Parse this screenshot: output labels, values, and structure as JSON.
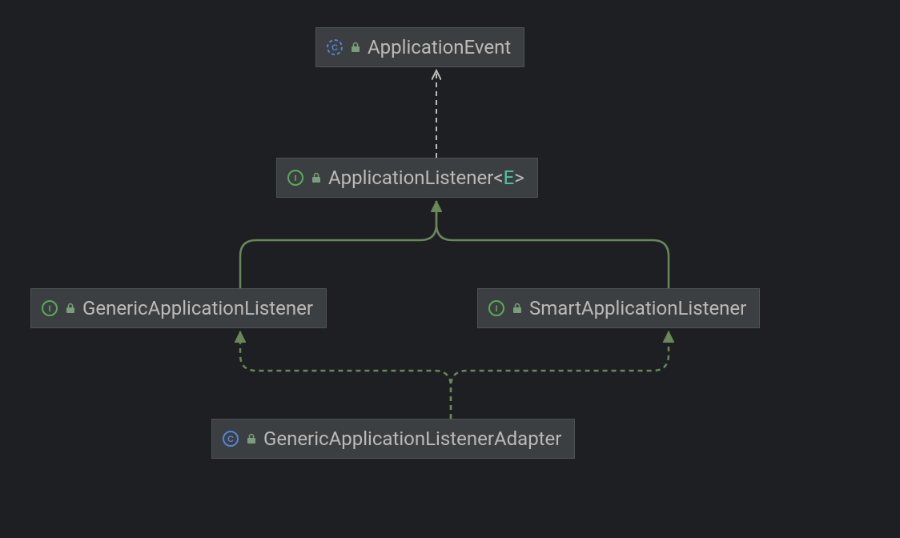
{
  "nodes": {
    "applicationEvent": {
      "label": "ApplicationEvent",
      "kind": "abstract-class"
    },
    "applicationListener": {
      "label": "ApplicationListener",
      "typeParam": "E",
      "kind": "interface"
    },
    "genericApplicationListener": {
      "label": "GenericApplicationListener",
      "kind": "interface"
    },
    "smartApplicationListener": {
      "label": "SmartApplicationListener",
      "kind": "interface"
    },
    "genericApplicationListenerAdapter": {
      "label": "GenericApplicationListenerAdapter",
      "kind": "class"
    }
  },
  "relationships": [
    {
      "from": "applicationListener",
      "to": "applicationEvent",
      "type": "dependency"
    },
    {
      "from": "genericApplicationListener",
      "to": "applicationListener",
      "type": "realization"
    },
    {
      "from": "smartApplicationListener",
      "to": "applicationListener",
      "type": "realization"
    },
    {
      "from": "genericApplicationListenerAdapter",
      "to": "genericApplicationListener",
      "type": "realization-dashed"
    },
    {
      "from": "genericApplicationListenerAdapter",
      "to": "smartApplicationListener",
      "type": "realization-dashed"
    }
  ],
  "colors": {
    "interface": "#5ca85c",
    "class": "#5583d6",
    "classAbstract": "#5583d6",
    "lock": "#7a9e7a",
    "arrow": "#6a8759",
    "dashedArrow": "#bbbbbb",
    "typeParam": "#4fc3a1"
  }
}
